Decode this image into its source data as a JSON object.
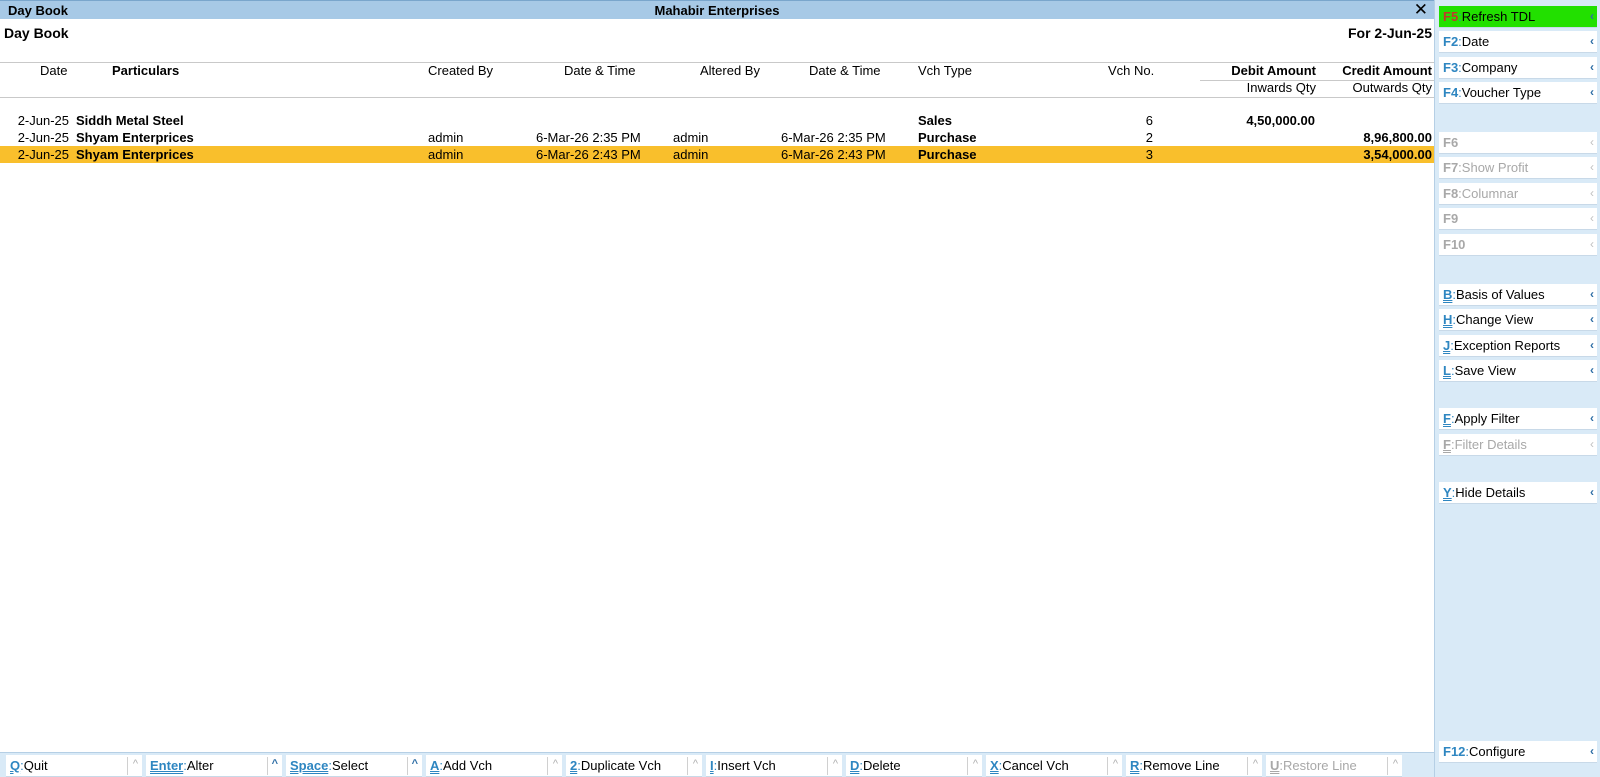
{
  "window": {
    "title_left": "Day Book",
    "company": "Mahabir Enterprises",
    "close_glyph": "✕"
  },
  "report": {
    "name": "Day Book",
    "period": "For 2-Jun-25"
  },
  "columns": {
    "date": "Date",
    "particulars": "Particulars",
    "created_by": "Created By",
    "created_dt": "Date & Time",
    "altered_by": "Altered By",
    "altered_dt": "Date & Time",
    "vch_type": "Vch Type",
    "vch_no": "Vch No.",
    "debit": "Debit Amount",
    "credit": "Credit Amount",
    "inwards": "Inwards Qty",
    "outwards": "Outwards Qty"
  },
  "rows": [
    {
      "date": "2-Jun-25",
      "particulars": "Siddh Metal Steel",
      "created_by": "",
      "created_dt": "",
      "altered_by": "",
      "altered_dt": "",
      "vch_type": "Sales",
      "vch_no": "6",
      "debit": "4,50,000.00",
      "credit": ""
    },
    {
      "date": "2-Jun-25",
      "particulars": "Shyam Enterprices",
      "created_by": "admin",
      "created_dt": "6-Mar-26 2:35 PM",
      "altered_by": "admin",
      "altered_dt": "6-Mar-26 2:35 PM",
      "vch_type": "Purchase",
      "vch_no": "2",
      "debit": "",
      "credit": "8,96,800.00"
    },
    {
      "date": "2-Jun-25",
      "particulars": "Shyam Enterprices",
      "created_by": "admin",
      "created_dt": "6-Mar-26 2:43 PM",
      "altered_by": "admin",
      "altered_dt": "6-Mar-26 2:43 PM",
      "vch_type": "Purchase",
      "vch_no": "3",
      "debit": "",
      "credit": "3,54,000.00"
    }
  ],
  "sidebar": [
    {
      "key": "F5",
      "label": "Refresh TDL",
      "state": "active"
    },
    {
      "key": "F2",
      "label": "Date",
      "state": "enabled"
    },
    {
      "key": "F3",
      "label": "Company",
      "state": "enabled"
    },
    {
      "key": "F4",
      "label": "Voucher Type",
      "state": "enabled"
    },
    {
      "key": "F6",
      "label": "",
      "state": "disabled"
    },
    {
      "key": "F7",
      "label": "Show Profit",
      "state": "disabled"
    },
    {
      "key": "F8",
      "label": "Columnar",
      "state": "disabled"
    },
    {
      "key": "F9",
      "label": "",
      "state": "disabled"
    },
    {
      "key": "F10",
      "label": "",
      "state": "disabled"
    },
    {
      "key": "B",
      "label": "Basis of Values",
      "state": "enabled"
    },
    {
      "key": "H",
      "label": "Change View",
      "state": "enabled"
    },
    {
      "key": "J",
      "label": "Exception Reports",
      "state": "enabled"
    },
    {
      "key": "L",
      "label": "Save View",
      "state": "enabled"
    },
    {
      "key": "F",
      "label": "Apply Filter",
      "state": "enabled"
    },
    {
      "key": "F",
      "label": "Filter Details",
      "state": "disabled"
    },
    {
      "key": "Y",
      "label": "Hide Details",
      "state": "enabled"
    },
    {
      "key": "F12",
      "label": "Configure",
      "state": "enabled"
    }
  ],
  "bottom": [
    {
      "key": "Q",
      "label": "Quit",
      "state": "enabled"
    },
    {
      "key": "Enter",
      "label": "Alter",
      "state": "enabled"
    },
    {
      "key": "Space",
      "label": "Select",
      "state": "enabled"
    },
    {
      "key": "A",
      "label": "Add Vch",
      "state": "enabled"
    },
    {
      "key": "2",
      "label": "Duplicate Vch",
      "state": "enabled"
    },
    {
      "key": "I",
      "label": "Insert Vch",
      "state": "enabled"
    },
    {
      "key": "D",
      "label": "Delete",
      "state": "enabled"
    },
    {
      "key": "X",
      "label": "Cancel Vch",
      "state": "enabled"
    },
    {
      "key": "R",
      "label": "Remove Line",
      "state": "enabled"
    },
    {
      "key": "U",
      "label": "Restore Line",
      "state": "disabled"
    }
  ],
  "glyphs": {
    "sidebar_arrow": "‹",
    "bottom_arrow": "^"
  },
  "colors": {
    "selected_row": "#f9bf2c",
    "active_button": "#22e000",
    "title_bar": "#a7c9e6",
    "panel": "#d9eaf7",
    "hotkey": "#2e86c1"
  }
}
